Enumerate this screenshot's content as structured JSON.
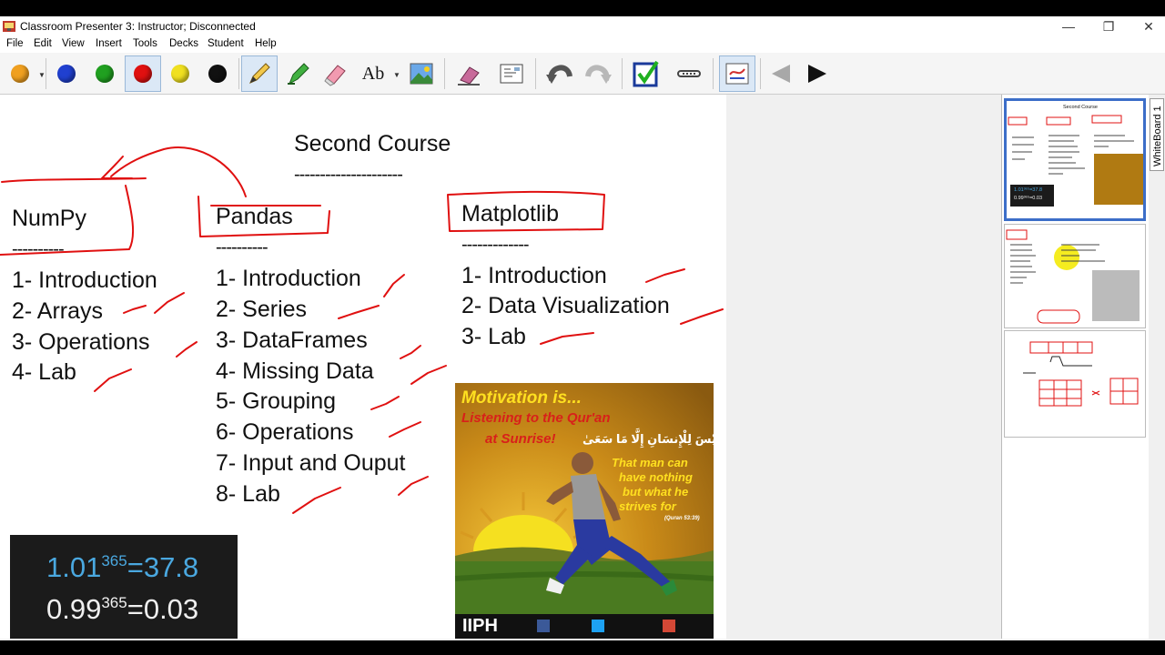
{
  "window": {
    "title": "Classroom Presenter 3: Instructor; Disconnected",
    "minimize_glyph": "—",
    "restore_glyph": "❐",
    "close_glyph": "✕"
  },
  "menu": [
    "File",
    "Edit",
    "View",
    "Insert",
    "Tools",
    "Decks",
    "Student",
    "Help"
  ],
  "toolbar": {
    "pens": [
      {
        "name": "orange",
        "color": "#f0a020"
      },
      {
        "name": "blue",
        "color": "#2040d0"
      },
      {
        "name": "green",
        "color": "#20a020"
      },
      {
        "name": "red",
        "color": "#e01010"
      },
      {
        "name": "yellow",
        "color": "#f0e020"
      },
      {
        "name": "black",
        "color": "#111111"
      }
    ],
    "text_tool_label": "Ab"
  },
  "slide": {
    "title": "Second Course",
    "title_underline": "---------------------",
    "columns": [
      {
        "heading": "NumPy",
        "underline": "----------",
        "items": [
          "1- Introduction",
          "2- Arrays",
          "3- Operations",
          "4- Lab"
        ]
      },
      {
        "heading": "Pandas",
        "underline": "----------",
        "items": [
          "1- Introduction",
          "2- Series",
          "3- DataFrames",
          "4- Missing Data",
          "5- Grouping",
          "6- Operations",
          "7- Input and Ouput",
          "8- Lab"
        ]
      },
      {
        "heading": "Matplotlib",
        "underline": "-------------",
        "items": [
          "1- Introduction",
          "2- Data Visualization",
          "3- Lab"
        ]
      }
    ],
    "formula": {
      "line1_base": "1.01",
      "line1_exp": "365",
      "line1_result": "=37.8",
      "line2_base": "0.99",
      "line2_exp": "365",
      "line2_result": "=0.03"
    },
    "poster": {
      "headline": "Motivation is...",
      "line2": "Listening to the Qur'an",
      "line3": "at Sunrise!",
      "arabic": "وَأَن لَّيْسَ لِلْإِنسَانِ إِلَّا مَا سَعَىٰ",
      "quote": [
        "That man can",
        "have nothing",
        "but what he",
        "strives for"
      ],
      "citation": "(Quran 53:39)",
      "logo": "IIPH"
    }
  },
  "filmstrip": {
    "tab_label": "WhiteBoard 1",
    "slide1_title": "Second Course",
    "slide1_formula": [
      "1.01³⁶⁵=37.8",
      "0.99³⁶⁵=0.03"
    ]
  }
}
